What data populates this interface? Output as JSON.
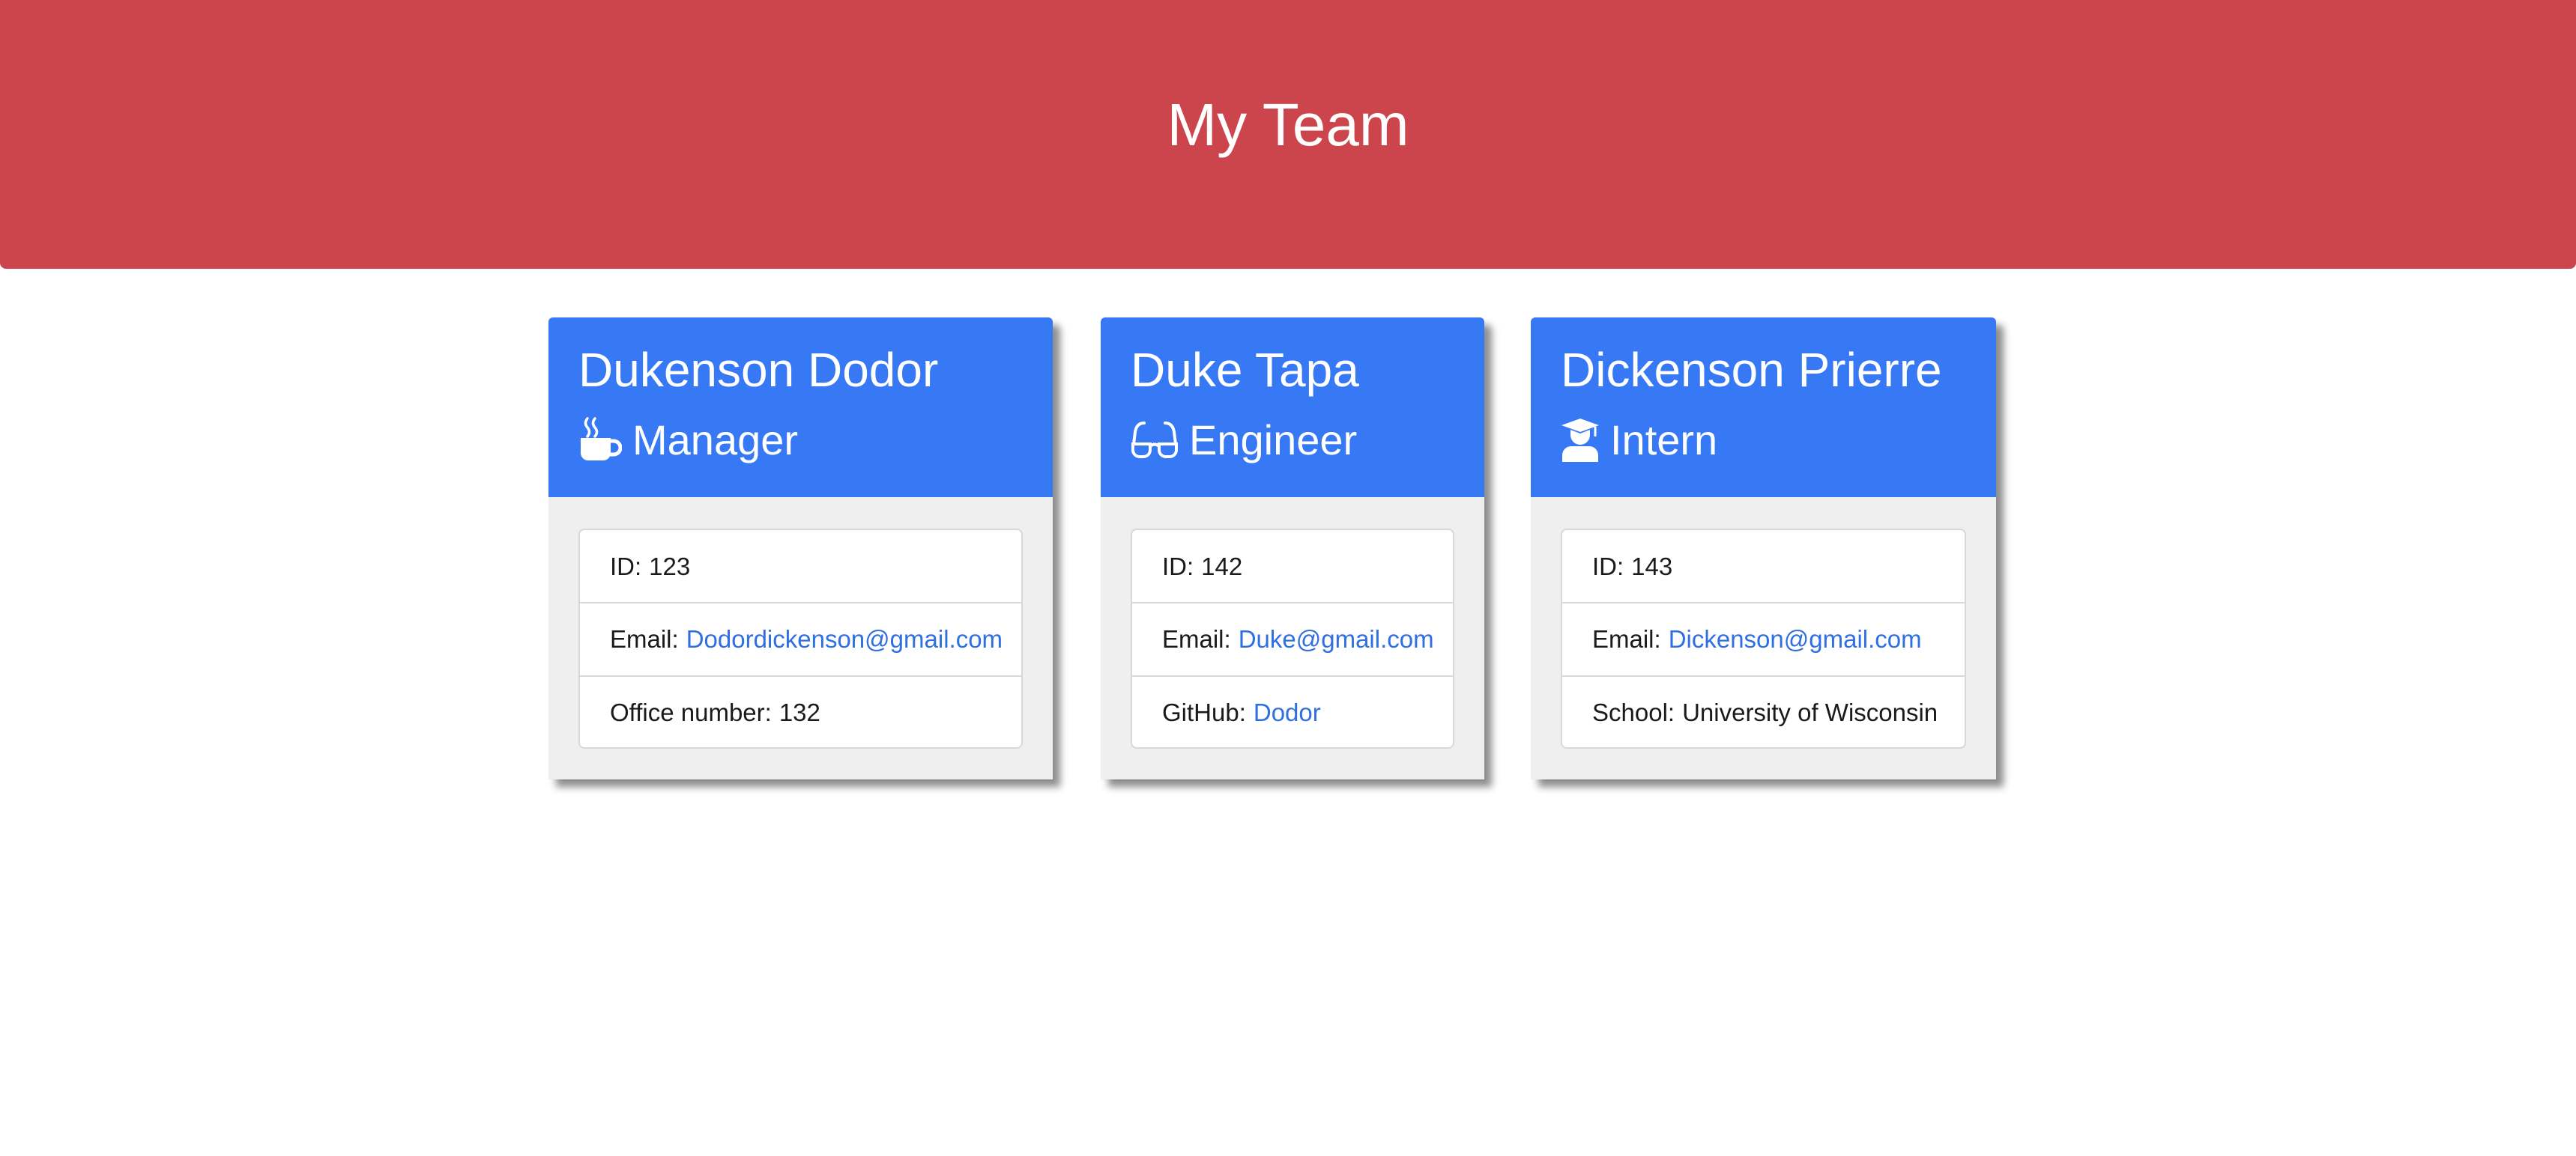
{
  "header": {
    "title": "My Team"
  },
  "team": [
    {
      "name": "Dukenson Dodor",
      "role": "Manager",
      "role_icon": "coffee-mug-icon",
      "id_label": "ID:",
      "id_value": "123",
      "email_label": "Email:",
      "email_value": "Dodordickenson@gmail.com",
      "extra_label": "Office number:",
      "extra_value": "132"
    },
    {
      "name": "Duke Tapa",
      "role": "Engineer",
      "role_icon": "glasses-icon",
      "id_label": "ID:",
      "id_value": "142",
      "email_label": "Email:",
      "email_value": "Duke@gmail.com",
      "extra_label": "GitHub:",
      "extra_value": "Dodor"
    },
    {
      "name": "Dickenson Prierre",
      "role": "Intern",
      "role_icon": "graduate-icon",
      "id_label": "ID:",
      "id_value": "143",
      "email_label": "Email:",
      "email_value": "Dickenson@gmail.com",
      "extra_label": "School:",
      "extra_value": "University of Wisconsin"
    }
  ],
  "colors": {
    "header_background": "#cd454c",
    "card_header": "#3779f4",
    "card_body": "#efefef",
    "link": "#2f6fe0"
  }
}
